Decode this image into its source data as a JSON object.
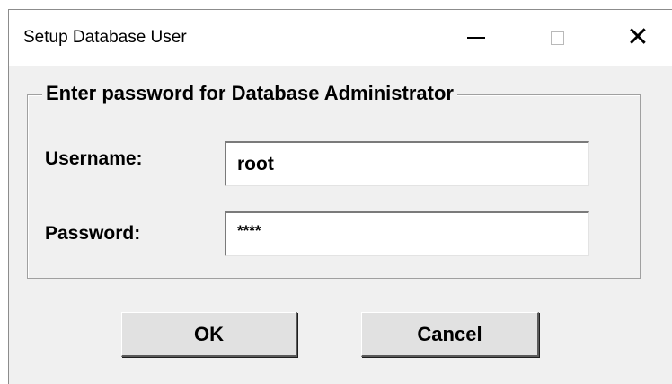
{
  "window": {
    "title": "Setup Database User",
    "controls": {
      "minimize_icon": "minimize-icon",
      "maximize_icon": "maximize-icon",
      "close_icon": "close-icon",
      "close_glyph": "✕"
    }
  },
  "group": {
    "legend": "Enter password for Database Administrator"
  },
  "form": {
    "username_label": "Username:",
    "username_value": "root",
    "password_label": "Password:",
    "password_value": "****"
  },
  "buttons": {
    "ok_label": "OK",
    "cancel_label": "Cancel"
  },
  "colors": {
    "dialog_background": "#f0f0f0",
    "titlebar_background": "#ffffff",
    "button_face": "#e1e1e1"
  }
}
